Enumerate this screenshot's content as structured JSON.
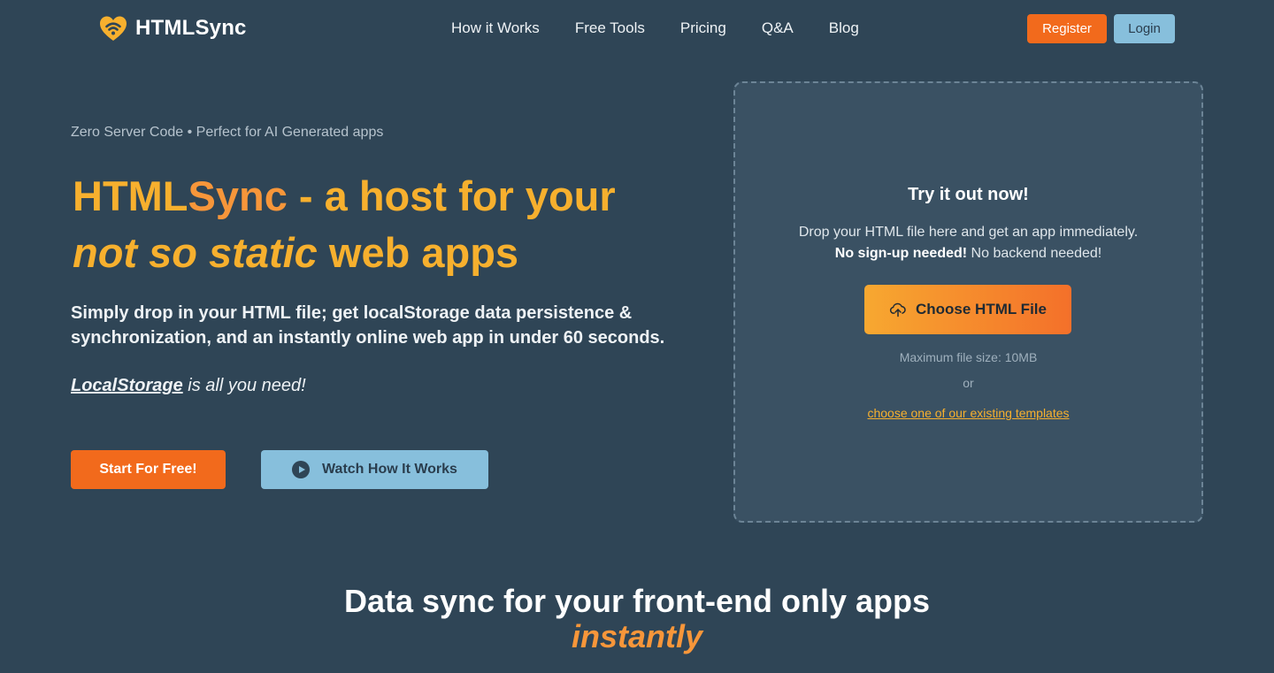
{
  "header": {
    "brand": "HTMLSync",
    "nav": [
      {
        "label": "How it Works"
      },
      {
        "label": "Free Tools"
      },
      {
        "label": "Pricing"
      },
      {
        "label": "Q&A"
      },
      {
        "label": "Blog"
      }
    ],
    "register_label": "Register",
    "login_label": "Login",
    "logo_icon": "heart-wifi-icon"
  },
  "hero": {
    "tagline": "Zero Server Code • Perfect for AI Generated apps",
    "title_brand_part1": "HTML",
    "title_brand_part2": "Sync",
    "title_rest": " - a host for your",
    "title_italic": "not so static",
    "title_end": " web apps",
    "description": "Simply drop in your HTML file; get localStorage data persistence & synchronization, and an instantly online web app in under 60 seconds.",
    "note_link": "LocalStorage",
    "note_rest": " is all you need!",
    "start_label": "Start For Free!",
    "watch_label": "Watch How It Works"
  },
  "dropzone": {
    "title": "Try it out now!",
    "line1": "Drop your HTML file here and get an app immediately.",
    "line2_bold": "No sign-up needed!",
    "line2_rest": " No backend needed!",
    "choose_label": "Choose HTML File",
    "max_size": "Maximum file size: 10MB",
    "or": "or",
    "templates_link": "choose one of our existing templates"
  },
  "section": {
    "title": "Data sync for your front-end only apps",
    "subtitle": "instantly"
  },
  "colors": {
    "background": "#2f4556",
    "accent_orange": "#f26a1c",
    "accent_yellow": "#f7b02e",
    "accent_blue": "#87bfdc"
  }
}
